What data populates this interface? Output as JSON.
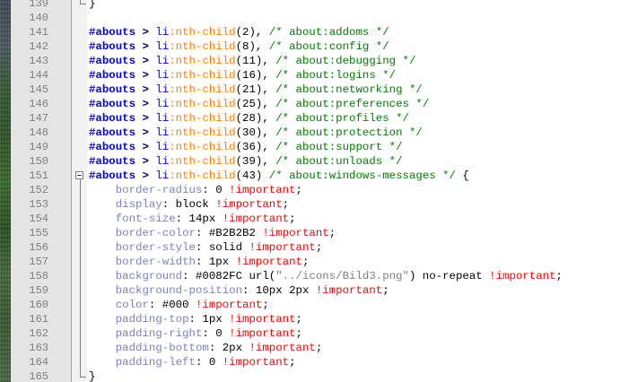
{
  "colors": {
    "selector": "#0000ff",
    "operator": "#000080",
    "pseudo": "#ff8000",
    "comment": "#008000",
    "property": "#8080c0",
    "important": "#ff0000",
    "string": "#808080",
    "line_number": "#808080"
  },
  "editor": {
    "lines": [
      {
        "n": "139",
        "fold": "end",
        "tokens": [
          {
            "t": "}",
            "c": "punc"
          }
        ]
      },
      {
        "n": "140",
        "fold": "",
        "tokens": []
      },
      {
        "n": "141",
        "fold": "",
        "tokens": [
          {
            "t": "#abouts",
            "c": "sel"
          },
          {
            "t": " > ",
            "c": "op"
          },
          {
            "t": "li",
            "c": "tag"
          },
          {
            "t": ":nth-child",
            "c": "pseudo"
          },
          {
            "t": "(2), ",
            "c": "punc"
          },
          {
            "t": "/* about:addoms */",
            "c": "cmt"
          }
        ]
      },
      {
        "n": "142",
        "fold": "",
        "tokens": [
          {
            "t": "#abouts",
            "c": "sel"
          },
          {
            "t": " > ",
            "c": "op"
          },
          {
            "t": "li",
            "c": "tag"
          },
          {
            "t": ":nth-child",
            "c": "pseudo"
          },
          {
            "t": "(8), ",
            "c": "punc"
          },
          {
            "t": "/* about:config */",
            "c": "cmt"
          }
        ]
      },
      {
        "n": "143",
        "fold": "",
        "tokens": [
          {
            "t": "#abouts",
            "c": "sel"
          },
          {
            "t": " > ",
            "c": "op"
          },
          {
            "t": "li",
            "c": "tag"
          },
          {
            "t": ":nth-child",
            "c": "pseudo"
          },
          {
            "t": "(11), ",
            "c": "punc"
          },
          {
            "t": "/* about:debugging */",
            "c": "cmt"
          }
        ]
      },
      {
        "n": "144",
        "fold": "",
        "tokens": [
          {
            "t": "#abouts",
            "c": "sel"
          },
          {
            "t": " > ",
            "c": "op"
          },
          {
            "t": "li",
            "c": "tag"
          },
          {
            "t": ":nth-child",
            "c": "pseudo"
          },
          {
            "t": "(16), ",
            "c": "punc"
          },
          {
            "t": "/* about:logins */",
            "c": "cmt"
          }
        ]
      },
      {
        "n": "145",
        "fold": "",
        "tokens": [
          {
            "t": "#abouts",
            "c": "sel"
          },
          {
            "t": " > ",
            "c": "op"
          },
          {
            "t": "li",
            "c": "tag"
          },
          {
            "t": ":nth-child",
            "c": "pseudo"
          },
          {
            "t": "(21), ",
            "c": "punc"
          },
          {
            "t": "/* about:networking */",
            "c": "cmt"
          }
        ]
      },
      {
        "n": "146",
        "fold": "",
        "tokens": [
          {
            "t": "#abouts",
            "c": "sel"
          },
          {
            "t": " > ",
            "c": "op"
          },
          {
            "t": "li",
            "c": "tag"
          },
          {
            "t": ":nth-child",
            "c": "pseudo"
          },
          {
            "t": "(25), ",
            "c": "punc"
          },
          {
            "t": "/* about:preferences */",
            "c": "cmt"
          }
        ]
      },
      {
        "n": "147",
        "fold": "",
        "tokens": [
          {
            "t": "#abouts",
            "c": "sel"
          },
          {
            "t": " > ",
            "c": "op"
          },
          {
            "t": "li",
            "c": "tag"
          },
          {
            "t": ":nth-child",
            "c": "pseudo"
          },
          {
            "t": "(28), ",
            "c": "punc"
          },
          {
            "t": "/* about:profiles */",
            "c": "cmt"
          }
        ]
      },
      {
        "n": "148",
        "fold": "",
        "tokens": [
          {
            "t": "#abouts",
            "c": "sel"
          },
          {
            "t": " > ",
            "c": "op"
          },
          {
            "t": "li",
            "c": "tag"
          },
          {
            "t": ":nth-child",
            "c": "pseudo"
          },
          {
            "t": "(30), ",
            "c": "punc"
          },
          {
            "t": "/* about:protection */",
            "c": "cmt"
          }
        ]
      },
      {
        "n": "149",
        "fold": "",
        "tokens": [
          {
            "t": "#abouts",
            "c": "sel"
          },
          {
            "t": " > ",
            "c": "op"
          },
          {
            "t": "li",
            "c": "tag"
          },
          {
            "t": ":nth-child",
            "c": "pseudo"
          },
          {
            "t": "(36), ",
            "c": "punc"
          },
          {
            "t": "/* about:support */",
            "c": "cmt"
          }
        ]
      },
      {
        "n": "150",
        "fold": "",
        "tokens": [
          {
            "t": "#abouts",
            "c": "sel"
          },
          {
            "t": " > ",
            "c": "op"
          },
          {
            "t": "li",
            "c": "tag"
          },
          {
            "t": ":nth-child",
            "c": "pseudo"
          },
          {
            "t": "(39), ",
            "c": "punc"
          },
          {
            "t": "/* about:unloads */",
            "c": "cmt"
          }
        ]
      },
      {
        "n": "151",
        "fold": "start",
        "tokens": [
          {
            "t": "#abouts",
            "c": "sel"
          },
          {
            "t": " > ",
            "c": "op"
          },
          {
            "t": "li",
            "c": "tag"
          },
          {
            "t": ":nth-child",
            "c": "pseudo"
          },
          {
            "t": "(43) ",
            "c": "punc"
          },
          {
            "t": "/* about:windows-messages */",
            "c": "cmt"
          },
          {
            "t": " {",
            "c": "punc"
          }
        ]
      },
      {
        "n": "152",
        "fold": "",
        "tokens": [
          {
            "t": "    border-radius",
            "c": "prop"
          },
          {
            "t": ": 0 ",
            "c": "val"
          },
          {
            "t": "!important",
            "c": "imp"
          },
          {
            "t": ";",
            "c": "punc"
          }
        ]
      },
      {
        "n": "153",
        "fold": "",
        "tokens": [
          {
            "t": "    display",
            "c": "prop"
          },
          {
            "t": ": block ",
            "c": "val"
          },
          {
            "t": "!important",
            "c": "imp"
          },
          {
            "t": ";",
            "c": "punc"
          }
        ]
      },
      {
        "n": "154",
        "fold": "",
        "tokens": [
          {
            "t": "    font-size",
            "c": "prop"
          },
          {
            "t": ": 14px ",
            "c": "val"
          },
          {
            "t": "!important",
            "c": "imp"
          },
          {
            "t": ";",
            "c": "punc"
          }
        ]
      },
      {
        "n": "155",
        "fold": "",
        "tokens": [
          {
            "t": "    border-color",
            "c": "prop"
          },
          {
            "t": ": #B2B2B2 ",
            "c": "val"
          },
          {
            "t": "!important",
            "c": "imp"
          },
          {
            "t": ";",
            "c": "punc"
          }
        ]
      },
      {
        "n": "156",
        "fold": "",
        "tokens": [
          {
            "t": "    border-style",
            "c": "prop"
          },
          {
            "t": ": solid ",
            "c": "val"
          },
          {
            "t": "!important",
            "c": "imp"
          },
          {
            "t": ";",
            "c": "punc"
          }
        ]
      },
      {
        "n": "157",
        "fold": "",
        "tokens": [
          {
            "t": "    border-width",
            "c": "prop"
          },
          {
            "t": ": 1px ",
            "c": "val"
          },
          {
            "t": "!important",
            "c": "imp"
          },
          {
            "t": ";",
            "c": "punc"
          }
        ]
      },
      {
        "n": "158",
        "fold": "",
        "tokens": [
          {
            "t": "    background",
            "c": "prop"
          },
          {
            "t": ": #0082FC url(",
            "c": "val"
          },
          {
            "t": "\"../icons/Bild3.png\"",
            "c": "str"
          },
          {
            "t": ") no-repeat ",
            "c": "val"
          },
          {
            "t": "!important",
            "c": "imp"
          },
          {
            "t": ";",
            "c": "punc"
          }
        ]
      },
      {
        "n": "159",
        "fold": "",
        "tokens": [
          {
            "t": "    background-position",
            "c": "prop"
          },
          {
            "t": ": 10px 2px ",
            "c": "val"
          },
          {
            "t": "!important",
            "c": "imp"
          },
          {
            "t": ";",
            "c": "punc"
          }
        ]
      },
      {
        "n": "160",
        "fold": "",
        "tokens": [
          {
            "t": "    color",
            "c": "prop"
          },
          {
            "t": ": #000 ",
            "c": "val"
          },
          {
            "t": "!important",
            "c": "imp"
          },
          {
            "t": ";",
            "c": "punc"
          }
        ]
      },
      {
        "n": "161",
        "fold": "",
        "tokens": [
          {
            "t": "    padding-top",
            "c": "prop"
          },
          {
            "t": ": 1px ",
            "c": "val"
          },
          {
            "t": "!important",
            "c": "imp"
          },
          {
            "t": ";",
            "c": "punc"
          }
        ]
      },
      {
        "n": "162",
        "fold": "",
        "tokens": [
          {
            "t": "    padding-right",
            "c": "prop"
          },
          {
            "t": ": 0 ",
            "c": "val"
          },
          {
            "t": "!important",
            "c": "imp"
          },
          {
            "t": ";",
            "c": "punc"
          }
        ]
      },
      {
        "n": "163",
        "fold": "",
        "tokens": [
          {
            "t": "    padding-bottom",
            "c": "prop"
          },
          {
            "t": ": 2px ",
            "c": "val"
          },
          {
            "t": "!important",
            "c": "imp"
          },
          {
            "t": ";",
            "c": "punc"
          }
        ]
      },
      {
        "n": "164",
        "fold": "",
        "tokens": [
          {
            "t": "    padding-left",
            "c": "prop"
          },
          {
            "t": ": 0 ",
            "c": "val"
          },
          {
            "t": "!important",
            "c": "imp"
          },
          {
            "t": ";",
            "c": "punc"
          }
        ]
      },
      {
        "n": "165",
        "fold": "end",
        "tokens": [
          {
            "t": "}",
            "c": "punc"
          }
        ]
      }
    ]
  }
}
